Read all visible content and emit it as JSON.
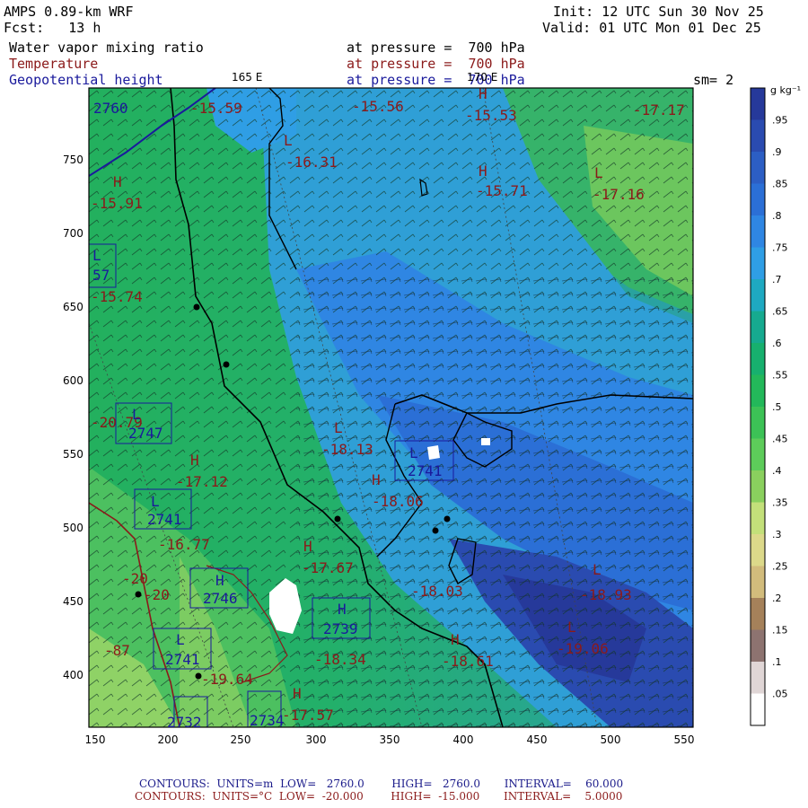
{
  "header": {
    "model": "AMPS 0.89-km WRF",
    "forecast_label": "Fcst:",
    "forecast_hours": "13 h",
    "init": "Init: 12 UTC Sun 30 Nov 25",
    "valid": "Valid: 01 UTC Mon 01 Dec 25",
    "fields": [
      {
        "name": "Water vapor mixing ratio",
        "level": "at pressure =  700 hPa",
        "color": "#000000"
      },
      {
        "name": "Temperature",
        "level": "at pressure =  700 hPa",
        "color": "#8b1a1a"
      },
      {
        "name": "Geopotential height",
        "level": "at pressure =  700 hPa",
        "color": "#1a1a9c"
      }
    ],
    "smoothing": "sm= 2"
  },
  "map": {
    "longitude_labels": [
      "165 E",
      "170 E"
    ],
    "x_ticks": [
      "150",
      "200",
      "250",
      "300",
      "350",
      "400",
      "450",
      "500",
      "550"
    ],
    "y_ticks": [
      "750",
      "700",
      "650",
      "600",
      "550",
      "500",
      "450",
      "400"
    ],
    "temperature_labels": [
      {
        "text": "-15.59",
        "mark": ""
      },
      {
        "text": "-15.56",
        "mark": ""
      },
      {
        "text": "-15.53",
        "mark": "H"
      },
      {
        "text": "-17.17",
        "mark": ""
      },
      {
        "text": "-16.31",
        "mark": "L"
      },
      {
        "text": "-15.71",
        "mark": "H"
      },
      {
        "text": "-17.16",
        "mark": "L"
      },
      {
        "text": "-15.91",
        "mark": "H"
      },
      {
        "text": "-15.74",
        "mark": "L"
      },
      {
        "text": "-20.79",
        "mark": "L"
      },
      {
        "text": "-18.13",
        "mark": "L"
      },
      {
        "text": "-17.12",
        "mark": "H"
      },
      {
        "text": "-18.06",
        "mark": "H"
      },
      {
        "text": "-16.77",
        "mark": ""
      },
      {
        "text": "-17.67",
        "mark": "H"
      },
      {
        "text": "-18.03",
        "mark": ""
      },
      {
        "text": "-18.93",
        "mark": "L"
      },
      {
        "text": "-19.06",
        "mark": "L"
      },
      {
        "text": "-18.34",
        "mark": ""
      },
      {
        "text": "-18.61",
        "mark": "H"
      },
      {
        "text": "-19.64",
        "mark": ""
      },
      {
        "text": "-17.57",
        "mark": "H"
      },
      {
        "text": "-20",
        "mark": ""
      },
      {
        "text": "-20",
        "mark": ""
      },
      {
        "text": "-87",
        "mark": ""
      }
    ],
    "height_labels": [
      {
        "text": "2760",
        "mark": ""
      },
      {
        "text": "57",
        "mark": "L"
      },
      {
        "text": "2747",
        "mark": "L"
      },
      {
        "text": "2741",
        "mark": "L"
      },
      {
        "text": "2741",
        "mark": "L"
      },
      {
        "text": "2746",
        "mark": "H"
      },
      {
        "text": "2739",
        "mark": "H"
      },
      {
        "text": "2741",
        "mark": "L"
      },
      {
        "text": "2732",
        "mark": ""
      },
      {
        "text": "2734",
        "mark": ""
      }
    ]
  },
  "colorbar": {
    "unit": "g kg⁻¹",
    "labels": [
      ".95",
      ".9",
      ".85",
      ".8",
      ".75",
      ".7",
      ".65",
      ".6",
      ".55",
      ".5",
      ".45",
      ".4",
      ".35",
      ".3",
      ".25",
      ".2",
      ".15",
      ".1",
      ".05"
    ],
    "colors": [
      "#26399a",
      "#2a4bb0",
      "#2c5ec4",
      "#2b6fd6",
      "#2f86e3",
      "#2f9ee5",
      "#1ea9c1",
      "#16aa8f",
      "#17b06e",
      "#23b85a",
      "#3cc256",
      "#5dcc5a",
      "#8ad05e",
      "#c3e07a",
      "#dcd98a",
      "#d2bc7c",
      "#a5815a",
      "#8d7370",
      "#e0d6d6",
      "#ffffff"
    ]
  },
  "footer": {
    "line1": {
      "label": "CONTOURS:",
      "units": "UNITS=m",
      "low": "LOW=   2760.0",
      "high": "HIGH=   2760.0",
      "interval": "INTERVAL=    60.000",
      "color": "#1a1a8a"
    },
    "line2": {
      "label": "CONTOURS:",
      "units": "UNITS=°C",
      "low": "LOW=  -20.000",
      "high": "HIGH=  -15.000",
      "interval": "INTERVAL=    5.0000",
      "color": "#8b1a1a"
    }
  }
}
